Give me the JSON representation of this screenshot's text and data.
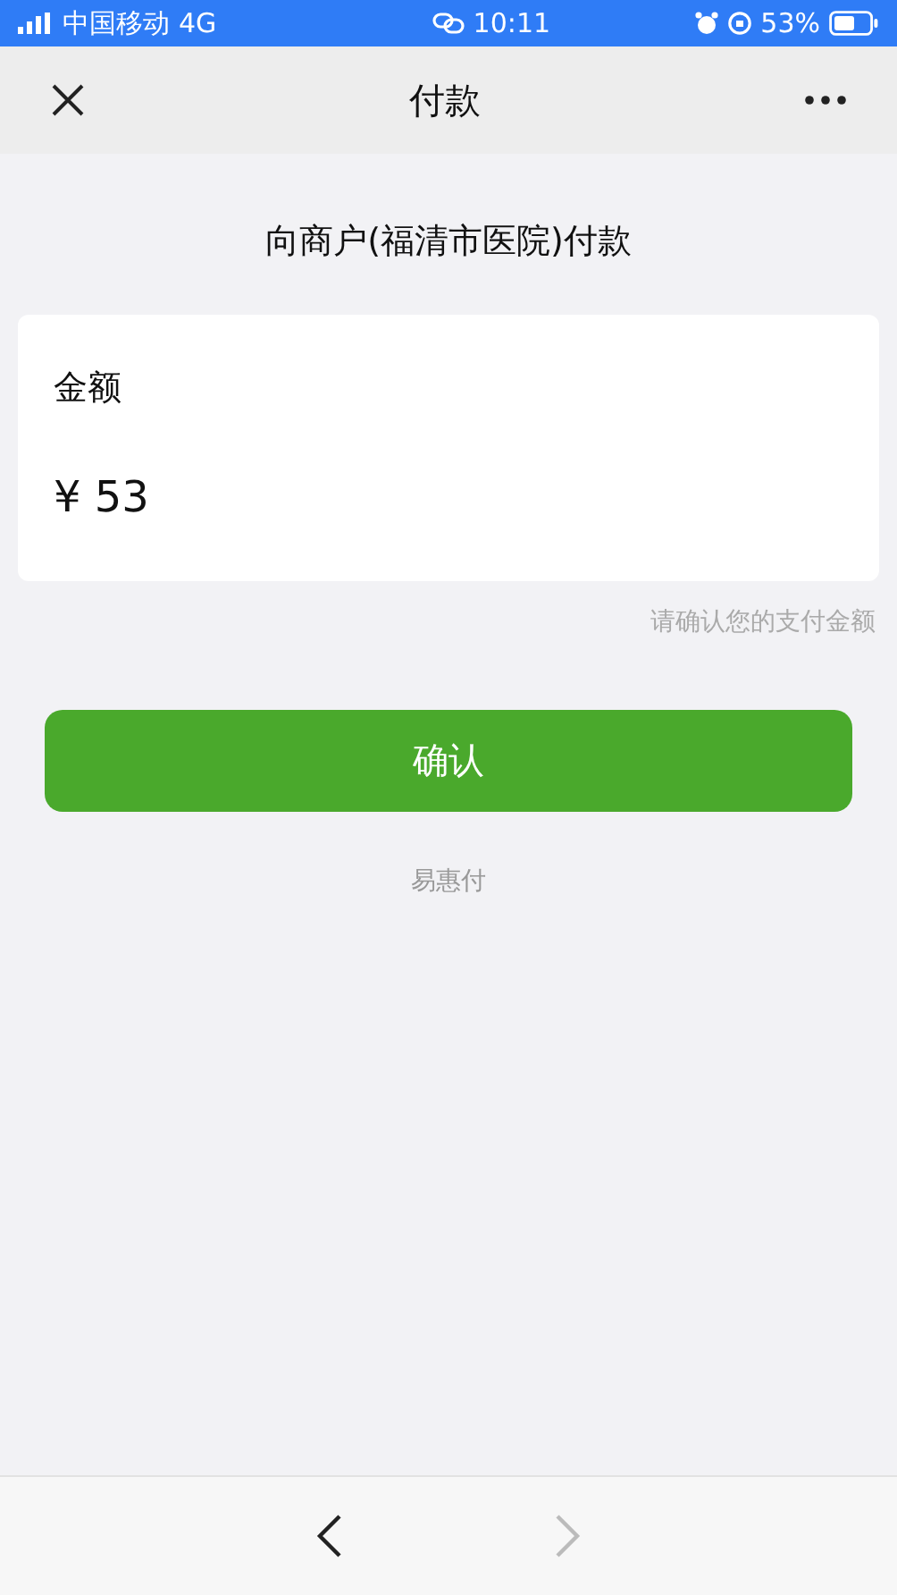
{
  "status_bar": {
    "carrier": "中国移动",
    "network": "4G",
    "time": "10:11",
    "battery": "53%"
  },
  "nav_bar": {
    "title": "付款"
  },
  "merchant": "向商户(福清市医院)付款",
  "amount_card": {
    "label": "金额",
    "value": "¥ 53"
  },
  "hint": "请确认您的支付金额",
  "confirm_button": "确认",
  "provider": "易惠付",
  "browser_bar": {
    "back": {
      "disabled": false
    },
    "forward": {
      "disabled": true
    }
  }
}
